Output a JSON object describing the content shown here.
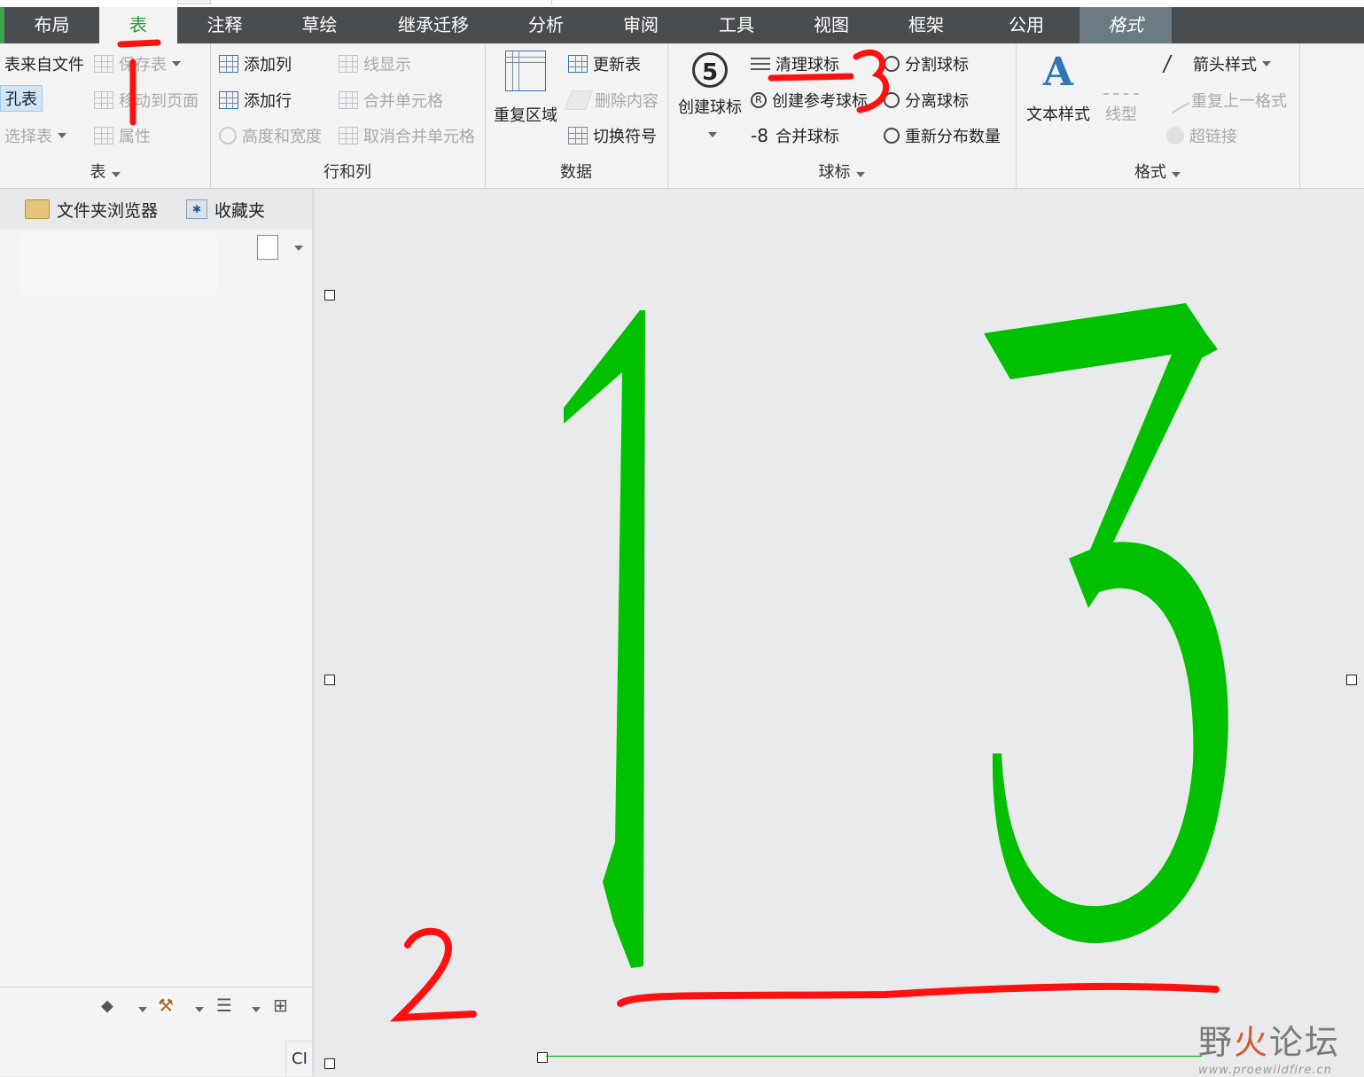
{
  "tabs": [
    {
      "label": "布局"
    },
    {
      "label": "表"
    },
    {
      "label": "注释"
    },
    {
      "label": "草绘"
    },
    {
      "label": "继承迁移"
    },
    {
      "label": "分析"
    },
    {
      "label": "审阅"
    },
    {
      "label": "工具"
    },
    {
      "label": "视图"
    },
    {
      "label": "框架"
    },
    {
      "label": "公用"
    },
    {
      "label": "格式"
    }
  ],
  "active_tab": "表",
  "ribbon": {
    "table_group": {
      "label": "表",
      "from_file": "表来自文件",
      "save_table": "保存表",
      "hole_table": "孔表",
      "move_to_page": "移动到页面",
      "select_table": "选择表",
      "properties": "属性"
    },
    "rows_cols_group": {
      "label": "行和列",
      "add_column": "添加列",
      "line_display": "线显示",
      "add_row": "添加行",
      "merge_cells": "合并单元格",
      "height_width": "高度和宽度",
      "unmerge_cells": "取消合并单元格"
    },
    "data_group": {
      "label": "数据",
      "repeat_region": "重复区域",
      "update_table": "更新表",
      "delete_content": "删除内容",
      "switch_symbol": "切换符号"
    },
    "balloon_group": {
      "label": "球标",
      "create_balloon": "创建球标",
      "balloon_number": "5",
      "clean_balloon": "清理球标",
      "create_ref_balloon": "创建参考球标",
      "merge_balloon": "合并球标",
      "split_balloon": "分割球标",
      "detach_balloon": "分离球标",
      "redistribute_qty": "重新分布数量"
    },
    "format_group": {
      "label": "格式",
      "text_style": "文本样式",
      "line_style": "线型",
      "arrow_style": "箭头样式",
      "repeat_last_format": "重复上一格式",
      "hyperlink": "超链接"
    }
  },
  "sidebar": {
    "tab_folder_browser": "文件夹浏览器",
    "tab_favorites": "收藏夹",
    "bottom_text": "CI"
  },
  "annotations": {
    "mark_1": "1",
    "mark_2": "2",
    "mark_3": "3",
    "big_number": "13"
  },
  "watermark": {
    "text_a": "野",
    "text_b": "火",
    "text_c": "论坛",
    "url": "www.proewildfire.cn"
  },
  "colors": {
    "tabbar": "#4a4d50",
    "active_tab_text": "#2b9b3b",
    "annotation_red": "#ff1010",
    "balloon_green": "#00c000",
    "ribbon_bg": "#f3f3f3",
    "canvas_bg": "#e9eaec"
  }
}
